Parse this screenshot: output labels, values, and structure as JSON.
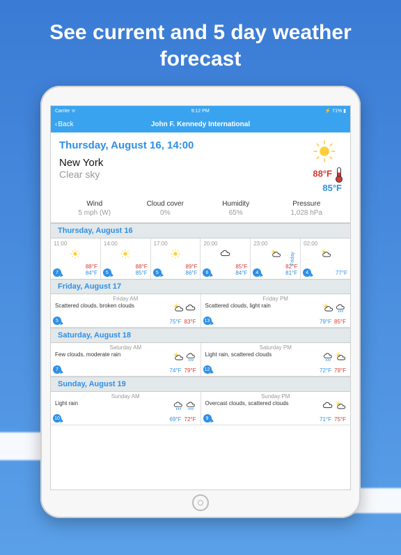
{
  "headline": "See current and 5 day weather forecast",
  "status": {
    "carrier": "Carrier",
    "time": "9:12 PM",
    "battery": "71%"
  },
  "nav": {
    "back": "Back",
    "title": "John F. Kennedy International"
  },
  "current": {
    "datetime": "Thursday, August 16, 14:00",
    "city": "New York",
    "condition": "Clear sky",
    "temp_hi": "88°F",
    "temp_lo": "85°F"
  },
  "metrics": [
    {
      "label": "Wind",
      "value": "5 mph (W)"
    },
    {
      "label": "Cloud cover",
      "value": "0%"
    },
    {
      "label": "Humidity",
      "value": "65%"
    },
    {
      "label": "Pressure",
      "value": "1,028 hPa"
    }
  ],
  "hourly": {
    "header": "Thursday, August 16",
    "cells": [
      {
        "time": "11:00",
        "hi": "88°F",
        "lo": "84°F",
        "wind": "7",
        "icon": "sun"
      },
      {
        "time": "14:00",
        "hi": "88°F",
        "lo": "85°F",
        "wind": "5",
        "icon": "sun"
      },
      {
        "time": "17:00",
        "hi": "89°F",
        "lo": "86°F",
        "wind": "5",
        "icon": "sun"
      },
      {
        "time": "20:00",
        "hi": "85°F",
        "lo": "84°F",
        "wind": "6",
        "icon": "cloud"
      },
      {
        "time": "23:00",
        "hi": "82°F",
        "lo": "81°F",
        "wind": "4",
        "icon": "cloud-sun",
        "divider": "Friday"
      },
      {
        "time": "02:00",
        "hi": "",
        "lo": "77°F",
        "wind": "4",
        "icon": "cloud-sun"
      }
    ]
  },
  "days": [
    {
      "header": "Friday, August 17",
      "halves": [
        {
          "period": "Friday AM",
          "cond": "Scattered clouds, broken clouds",
          "wind": "5",
          "lo": "75°F",
          "hi": "83°F",
          "icons": [
            "cloud-sun",
            "cloud"
          ]
        },
        {
          "period": "Friday PM",
          "cond": "Scattered clouds, light rain",
          "wind": "13",
          "lo": "79°F",
          "hi": "85°F",
          "icons": [
            "cloud-sun",
            "rain"
          ]
        }
      ]
    },
    {
      "header": "Saturday, August 18",
      "halves": [
        {
          "period": "Saturday AM",
          "cond": "Few clouds, moderate rain",
          "wind": "7",
          "lo": "74°F",
          "hi": "79°F",
          "icons": [
            "cloud-sun",
            "rain"
          ]
        },
        {
          "period": "Saturday PM",
          "cond": "Light rain, scattered clouds",
          "wind": "12",
          "lo": "72°F",
          "hi": "79°F",
          "icons": [
            "rain",
            "cloud-sun"
          ]
        }
      ]
    },
    {
      "header": "Sunday, August 19",
      "halves": [
        {
          "period": "Sunday AM",
          "cond": "Light rain",
          "wind": "10",
          "lo": "69°F",
          "hi": "72°F",
          "icons": [
            "rain",
            "rain"
          ]
        },
        {
          "period": "Sunday PM",
          "cond": "Overcast clouds, scattered clouds",
          "wind": "9",
          "lo": "71°F",
          "hi": "75°F",
          "icons": [
            "cloud",
            "cloud-sun"
          ]
        }
      ]
    }
  ]
}
